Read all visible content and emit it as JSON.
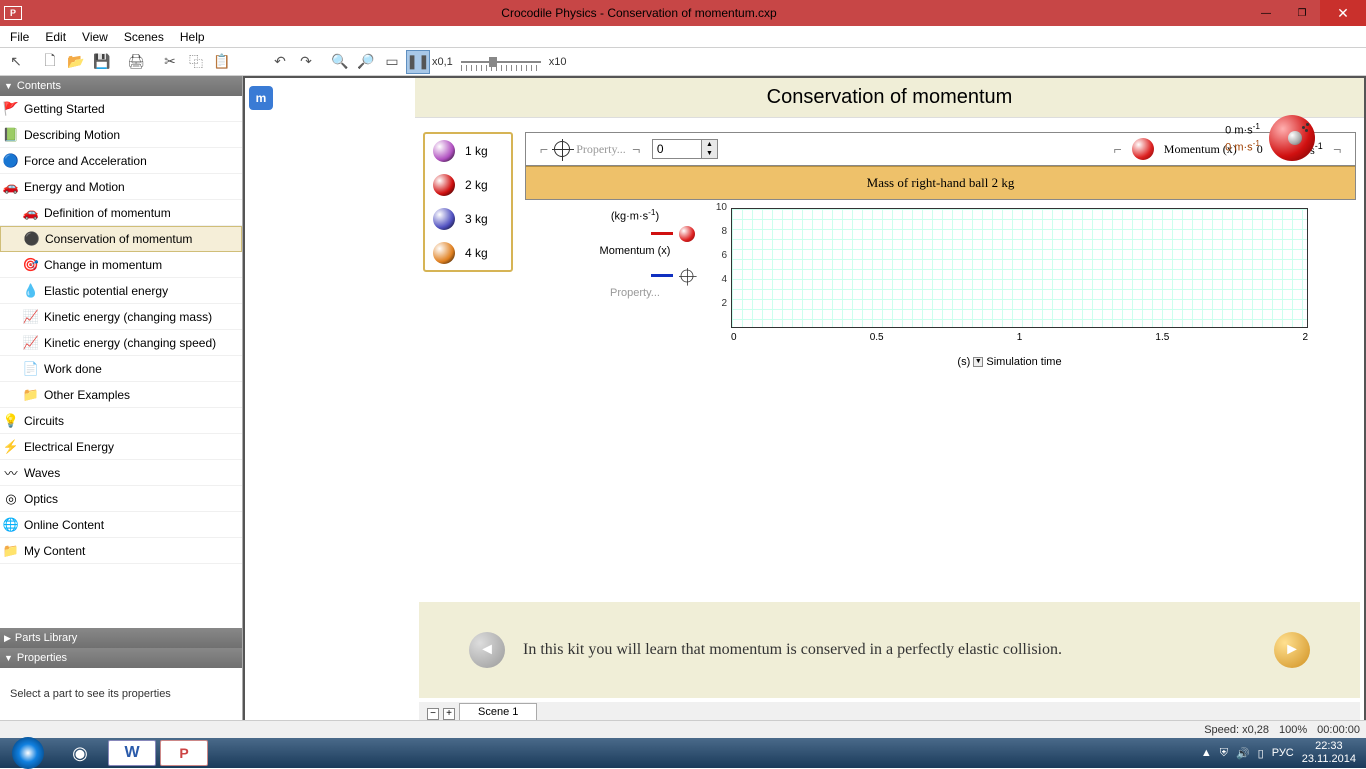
{
  "title": "Crocodile Physics - Conservation of momentum.cxp",
  "menu": [
    "File",
    "Edit",
    "View",
    "Scenes",
    "Help"
  ],
  "speed": {
    "left": "x0,1",
    "right": "x10"
  },
  "sidebar": {
    "contents_header": "Contents",
    "parts_header": "Parts Library",
    "props_header": "Properties",
    "props_hint": "Select a part to see its properties",
    "items": [
      {
        "label": "Getting Started",
        "lvl": 0
      },
      {
        "label": "Describing Motion",
        "lvl": 0
      },
      {
        "label": "Force and Acceleration",
        "lvl": 0
      },
      {
        "label": "Energy and Motion",
        "lvl": 0
      },
      {
        "label": "Definition of momentum",
        "lvl": 1
      },
      {
        "label": "Conservation of momentum",
        "lvl": 1,
        "selected": true
      },
      {
        "label": "Change in momentum",
        "lvl": 1
      },
      {
        "label": "Elastic potential energy",
        "lvl": 1
      },
      {
        "label": "Kinetic energy (changing mass)",
        "lvl": 1
      },
      {
        "label": "Kinetic energy (changing speed)",
        "lvl": 1
      },
      {
        "label": "Work done",
        "lvl": 1
      },
      {
        "label": "Other Examples",
        "lvl": 1
      },
      {
        "label": "Circuits",
        "lvl": 0
      },
      {
        "label": "Electrical Energy",
        "lvl": 0
      },
      {
        "label": "Waves",
        "lvl": 0
      },
      {
        "label": "Optics",
        "lvl": 0
      },
      {
        "label": "Online Content",
        "lvl": 0
      },
      {
        "label": "My Content",
        "lvl": 0
      }
    ]
  },
  "doc": {
    "title": "Conservation of momentum",
    "masses": [
      {
        "label": "1 kg",
        "color": "#b050c0"
      },
      {
        "label": "2 kg",
        "color": "#d01010"
      },
      {
        "label": "3 kg",
        "color": "#5050c0"
      },
      {
        "label": "4 kg",
        "color": "#e08020"
      }
    ],
    "property_label": "Property...",
    "spinner_value": "0",
    "momentum_label": "Momentum (x)",
    "momentum_value": "0",
    "momentum_unit_html": "kg·m·s<sup>-1</sup>",
    "velo1_html": "0 m·s<sup>-1</sup>",
    "velo2_html": "0 m·s<sup>-1</sup>",
    "mass_banner": "Mass of right-hand ball  2  kg",
    "chart_ylabel_html": "(kg·m·s<sup>-1</sup>)",
    "legend1": "Momentum (x)",
    "legend2": "Property...",
    "xaxis_unit": "(s)",
    "xaxis_label": "Simulation time",
    "xticks": [
      "0",
      "0.5",
      "1",
      "1.5",
      "2"
    ],
    "yticks": [
      "10",
      "8",
      "6",
      "4",
      "2"
    ],
    "instruction": "In this kit you will learn that momentum is conserved in a perfectly elastic collision."
  },
  "chart_data": {
    "type": "line",
    "title": "",
    "xlabel": "Simulation time",
    "ylabel": "(kg·m·s⁻¹)",
    "xlim": [
      0,
      2
    ],
    "ylim": [
      0,
      10
    ],
    "x_unit": "s",
    "x": [],
    "series": [
      {
        "name": "Momentum (x)",
        "color": "#d01010",
        "values": []
      },
      {
        "name": "Property...",
        "color": "#1030c0",
        "values": []
      }
    ]
  },
  "scene_tab": "Scene 1",
  "status": {
    "speed": "Speed: x0,28",
    "zoom": "100%",
    "time": "00:00:00"
  },
  "tray": {
    "lang": "РУС",
    "time": "22:33",
    "date": "23.11.2014"
  }
}
